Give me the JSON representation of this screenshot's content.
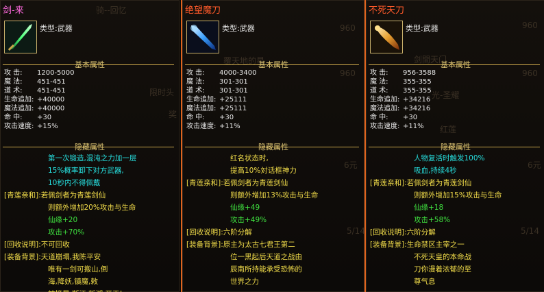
{
  "panels": [
    {
      "title": "剑-来",
      "title_color": "#ff6adf",
      "border_color": "#2c241a",
      "type_label": "类型:",
      "type_value": "武器",
      "basic_header": "基本属性",
      "stats": [
        {
          "label": "攻    击:",
          "value": "1200-5000"
        },
        {
          "label": "魔    法:",
          "value": "451-451"
        },
        {
          "label": "道    术:",
          "value": "451-451"
        },
        {
          "label": "生命追加:",
          "value": "+40000"
        },
        {
          "label": "魔法追加:",
          "value": "+40000"
        },
        {
          "label": "命    中:",
          "value": "+30"
        },
        {
          "label": "攻击速度:",
          "value": "+15%"
        }
      ],
      "hidden_header": "隐藏属性",
      "hidden": [
        {
          "tag": "",
          "text": "第一次锻造,混沌之力加一层",
          "color": "cyan"
        },
        {
          "tag": "",
          "text": "15%概率卸下对方武器,",
          "color": "cyan"
        },
        {
          "tag": "",
          "text": "10秒内不得佩戴",
          "color": "cyan"
        },
        {
          "tag": "[青莲亲和]:",
          "text": "若佩剑者为青莲剑仙",
          "color": "yellow"
        },
        {
          "tag": "",
          "text": "则额外增加20%攻击与生命",
          "color": "yellow"
        },
        {
          "tag": "",
          "text": "仙缘+20",
          "color": "green"
        },
        {
          "tag": "",
          "text": "攻击+70%",
          "color": "green"
        },
        {
          "tag": "[回收说明]:",
          "text": "不可回收",
          "color": "yellow"
        },
        {
          "tag": "[装备背景]:",
          "text": "天道崩塌,我陈平安",
          "color": "yellow"
        },
        {
          "tag": "",
          "text": "唯有一剑可搬山,倒",
          "color": "yellow"
        },
        {
          "tag": "",
          "text": "海,降妖,镇魔,敕",
          "color": "yellow"
        },
        {
          "tag": "",
          "text": "神摘星,断江,斩湖,开天!",
          "color": "yellow"
        }
      ],
      "ghost": [
        "疯人",
        "骑--回忆",
        "限时头",
        "奖"
      ]
    },
    {
      "title": "绝望魔刀",
      "title_color": "#ff5a2a",
      "border_color": "#e0641e",
      "type_label": "类型:",
      "type_value": "武器",
      "basic_header": "基本属性",
      "stats": [
        {
          "label": "攻    击:",
          "value": "4000-3400"
        },
        {
          "label": "魔    法:",
          "value": "301-301"
        },
        {
          "label": "道    术:",
          "value": "301-301"
        },
        {
          "label": "生命追加:",
          "value": "+25111"
        },
        {
          "label": "魔法追加:",
          "value": "+25111"
        },
        {
          "label": "命    中:",
          "value": "+30"
        },
        {
          "label": "攻击速度:",
          "value": "+11%"
        }
      ],
      "hidden_header": "隐藏属性",
      "hidden": [
        {
          "tag": "",
          "text": "红名状态时,",
          "color": "yellow"
        },
        {
          "tag": "",
          "text": "提高10%対话框神力",
          "color": "yellow"
        },
        {
          "tag": "[青莲亲和]:",
          "text": "若佩剑者为青莲剑仙",
          "color": "yellow"
        },
        {
          "tag": "",
          "text": "则额外增加13%攻击与生命",
          "color": "yellow"
        },
        {
          "tag": "",
          "text": "仙缘+49",
          "color": "green"
        },
        {
          "tag": "",
          "text": "攻击+49%",
          "color": "green"
        },
        {
          "tag": "[回收说明]:",
          "text": "六阶分解",
          "color": "yellow"
        },
        {
          "tag": "[装备背景]:",
          "text": "原主为太古七君王第二",
          "color": "yellow"
        },
        {
          "tag": "",
          "text": "位一黑起后天道之战由",
          "color": "yellow"
        },
        {
          "tag": "",
          "text": "辰南所持能承受恐怖的",
          "color": "yellow"
        },
        {
          "tag": "",
          "text": "世界之力",
          "color": "yellow"
        }
      ],
      "ghost": [
        "960",
        "覆天地的星",
        "960",
        "5/14",
        "6元"
      ]
    },
    {
      "title": "不死天刀",
      "title_color": "#ff5a2a",
      "border_color": "#e0641e",
      "type_label": "类型:",
      "type_value": "武器",
      "basic_header": "基本属性",
      "stats": [
        {
          "label": "攻    击:",
          "value": "956-3588"
        },
        {
          "label": "魔    法:",
          "value": "355-355"
        },
        {
          "label": "道    术:",
          "value": "355-355"
        },
        {
          "label": "生命追加:",
          "value": "+34216"
        },
        {
          "label": "魔法追加:",
          "value": "+34216"
        },
        {
          "label": "命    中:",
          "value": "+30"
        },
        {
          "label": "攻击速度:",
          "value": "+11%"
        }
      ],
      "hidden_header": "隐藏属性",
      "hidden": [
        {
          "tag": "",
          "text": "人物复活时触发100%",
          "color": "cyan"
        },
        {
          "tag": "",
          "text": "吸血,持续4秒",
          "color": "cyan"
        },
        {
          "tag": "[青莲亲和]:",
          "text": "若佩剑者为青莲剑仙",
          "color": "yellow"
        },
        {
          "tag": "",
          "text": "则额外增加15%攻击与生命",
          "color": "yellow"
        },
        {
          "tag": "",
          "text": "仙缘+18",
          "color": "green"
        },
        {
          "tag": "",
          "text": "攻击+58%",
          "color": "green"
        },
        {
          "tag": "[回收说明]:",
          "text": "六阶分解",
          "color": "yellow"
        },
        {
          "tag": "[装备背景]:",
          "text": "生命禁区主宰之一",
          "color": "yellow"
        },
        {
          "tag": "",
          "text": "不死天皇的本命战",
          "color": "yellow"
        },
        {
          "tag": "",
          "text": "刀你漫着浓郁的至",
          "color": "yellow"
        },
        {
          "tag": "",
          "text": "尊气息",
          "color": "yellow"
        }
      ],
      "ghost": [
        "960",
        "剑間天门",
        "960",
        "光-圣耀",
        "红莲",
        "6元",
        "5/14"
      ]
    }
  ]
}
